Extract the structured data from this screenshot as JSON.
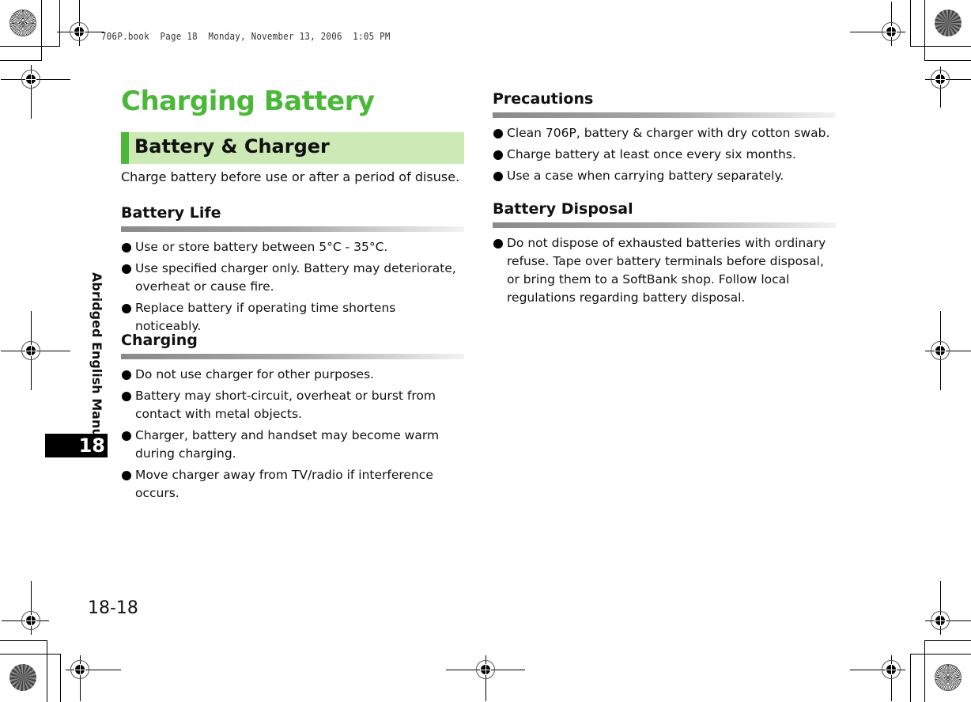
{
  "print_header": "706P.book  Page 18  Monday, November 13, 2006  1:05 PM",
  "side_tab": {
    "label": "Abridged English Manual",
    "chapter": "18"
  },
  "page_number": "18-18",
  "title": "Charging Battery",
  "banner": "Battery & Charger",
  "intro": "Charge battery before use or after a period of disuse.",
  "colors": {
    "accent_green": "#4cb83a",
    "banner_bg": "#cdeab6"
  },
  "sections": [
    {
      "heading": "Battery Life",
      "items": [
        "Use or store battery between 5°C - 35°C.",
        "Use specified charger only. Battery may deteriorate, overheat or cause fire.",
        "Replace battery if operating time shortens noticeably."
      ]
    },
    {
      "heading": "Charging",
      "items": [
        "Do not use charger for other purposes.",
        "Battery may short-circuit, overheat or burst from contact with metal objects.",
        "Charger, battery and handset may become warm during charging.",
        "Move charger away from TV/radio if interference occurs."
      ]
    },
    {
      "heading": "Precautions",
      "items": [
        "Clean 706P, battery & charger with dry cotton swab.",
        "Charge battery at least once every six months.",
        "Use a case when carrying battery separately."
      ]
    },
    {
      "heading": "Battery Disposal",
      "items": [
        "Do not dispose of exhausted batteries with ordinary refuse. Tape over battery terminals before disposal, or bring them to a SoftBank shop. Follow local regulations regarding battery disposal."
      ]
    }
  ]
}
